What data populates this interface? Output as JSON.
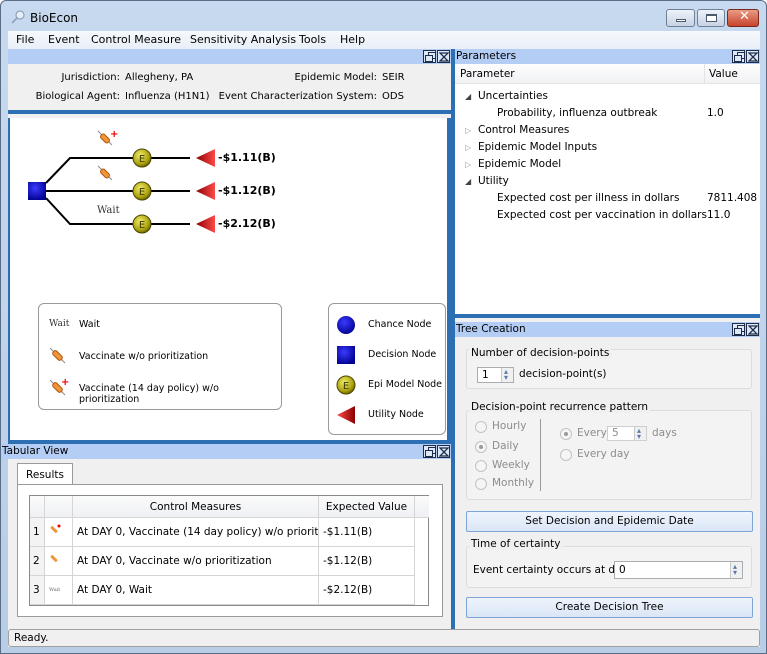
{
  "window": {
    "title": "BioEcon",
    "controls": [
      "minimize",
      "maximize",
      "close"
    ]
  },
  "menubar": [
    "File",
    "Event",
    "Control Measure",
    "Sensitivity Analysis",
    "Tools",
    "Help"
  ],
  "event_info": {
    "jurisdiction_label": "Jurisdiction:",
    "jurisdiction_value": "Allegheny, PA",
    "agent_label": "Biological Agent:",
    "agent_value": "Influenza (H1N1)",
    "epi_model_label": "Epidemic Model:",
    "epi_model_value": "SEIR",
    "ecs_label": "Event Characterization System:",
    "ecs_value": "ODS"
  },
  "decision_tree": {
    "branches": [
      {
        "action": "Vaccinate (14 day policy) w/o prioritization",
        "icon": "syringe-plus-icon",
        "node": "E",
        "value": "-$1.11(B)"
      },
      {
        "action": "Vaccinate w/o prioritization",
        "icon": "syringe-icon",
        "node": "E",
        "value": "-$1.12(B)"
      },
      {
        "action": "Wait",
        "icon_text": "Wait",
        "node": "E",
        "value": "-$2.12(B)"
      }
    ],
    "action_legend": [
      {
        "icon": "wait-icon",
        "icon_text": "Wait",
        "label": "Wait"
      },
      {
        "icon": "syringe-icon",
        "label": "Vaccinate w/o prioritization"
      },
      {
        "icon": "syringe-plus-icon",
        "label": "Vaccinate (14 day policy) w/o prioritization"
      }
    ],
    "node_legend": [
      {
        "icon": "chance-node-icon",
        "label": "Chance Node"
      },
      {
        "icon": "decision-node-icon",
        "label": "Decision Node"
      },
      {
        "icon": "epi-model-node-icon",
        "label": "Epi Model Node"
      },
      {
        "icon": "utility-node-icon",
        "label": "Utility Node"
      }
    ]
  },
  "tabular_view": {
    "title": "Tabular View",
    "tab": "Results",
    "columns": [
      "",
      "",
      "Control Measures",
      "Expected Value"
    ],
    "rows": [
      {
        "num": "1",
        "icon": "syringe-plus-icon",
        "measure": "At DAY 0, Vaccinate (14 day policy) w/o priorit...",
        "value": "-$1.11(B)"
      },
      {
        "num": "2",
        "icon": "syringe-icon",
        "measure": "At DAY 0, Vaccinate w/o prioritization",
        "value": "-$1.12(B)"
      },
      {
        "num": "3",
        "icon": "wait-icon",
        "measure": "At DAY 0, Wait",
        "value": "-$2.12(B)"
      }
    ]
  },
  "parameters": {
    "title": "Parameters",
    "columns": [
      "Parameter",
      "Value"
    ],
    "rows": [
      {
        "label": "Uncertainties",
        "level": 0,
        "expanded": true,
        "value": ""
      },
      {
        "label": "Probability, influenza outbreak",
        "level": 1,
        "value": "1.0"
      },
      {
        "label": "Control Measures",
        "level": 0,
        "expanded": false,
        "value": ""
      },
      {
        "label": "Epidemic Model Inputs",
        "level": 0,
        "expanded": false,
        "value": ""
      },
      {
        "label": "Epidemic Model",
        "level": 0,
        "expanded": false,
        "value": ""
      },
      {
        "label": "Utility",
        "level": 0,
        "expanded": true,
        "value": ""
      },
      {
        "label": "Expected cost per illness in dollars",
        "level": 1,
        "value": "7811.408"
      },
      {
        "label": "Expected cost per vaccination in dollars",
        "level": 1,
        "value": "11.0"
      }
    ]
  },
  "tree_creation": {
    "title": "Tree Creation",
    "decision_points_group": "Number of decision-points",
    "decision_points_value": "1",
    "decision_points_suffix": "decision-point(s)",
    "recurrence_group": "Decision-point recurrence pattern",
    "recurrence_options": [
      {
        "label": "Hourly",
        "checked": false
      },
      {
        "label": "Daily",
        "checked": true
      },
      {
        "label": "Weekly",
        "checked": false
      },
      {
        "label": "Monthly",
        "checked": false
      }
    ],
    "every_label": "Every",
    "every_value": "5",
    "every_unit": "days",
    "every_checked": true,
    "every_day_label": "Every day",
    "every_day_checked": false,
    "set_date_button": "Set Decision and Epidemic Date",
    "certainty_group": "Time of certainty",
    "certainty_label": "Event certainty occurs at day",
    "certainty_value": "0",
    "create_button": "Create Decision Tree"
  },
  "status": "Ready."
}
